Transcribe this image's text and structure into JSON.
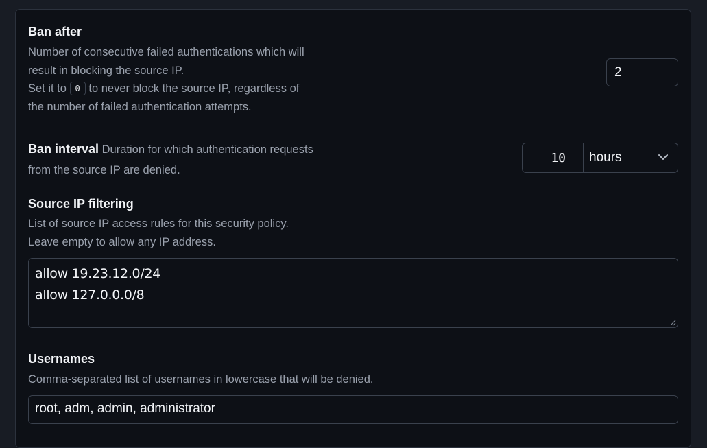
{
  "ban_after": {
    "label": "Ban after",
    "desc_line1": "Number of consecutive failed authentications which will",
    "desc_line2": "result in blocking the source IP.",
    "desc_line3_pre": "Set it to",
    "desc_line3_code": "0",
    "desc_line3_post": "to never block the source IP, regardless of",
    "desc_line4": "the number of failed authentication attempts.",
    "value": "2"
  },
  "ban_interval": {
    "label": "Ban interval",
    "desc_line1": "Duration for which authentication requests",
    "desc_line2": "from the source IP are denied.",
    "value": "10",
    "unit": "hours"
  },
  "source_ip": {
    "label": "Source IP filtering",
    "desc_line1": "List of source IP access rules for this security policy.",
    "desc_line2": "Leave empty to allow any IP address.",
    "rules": [
      "allow 19.23.12.0/24",
      "allow 127.0.0.0/8"
    ]
  },
  "usernames": {
    "label": "Usernames",
    "desc": "Comma-separated list of usernames in lowercase that will be denied.",
    "value": "root, adm, admin, administrator"
  },
  "colors": {
    "panel_bg": "#0d1016",
    "page_bg": "#181c24",
    "border": "#3a414d",
    "muted_text": "#9aa1ad"
  },
  "icons": {
    "select_arrow": "chevron-down-icon",
    "resize": "resize-grip-icon"
  }
}
